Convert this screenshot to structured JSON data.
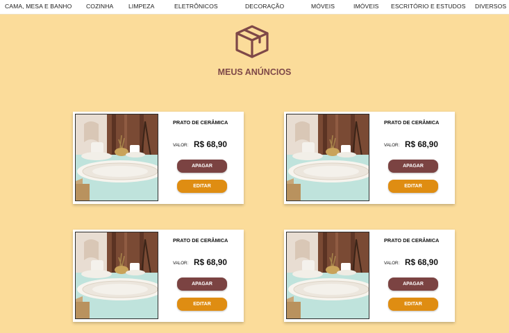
{
  "nav": [
    {
      "label": "CAMA, MESA E BANHO"
    },
    {
      "label": "COZINHA"
    },
    {
      "label": "LIMPEZA"
    },
    {
      "label": "ELETRÔNICOS"
    },
    {
      "label": "DECORAÇÃO"
    },
    {
      "label": "MÓVEIS"
    },
    {
      "label": "IMÓVEIS"
    },
    {
      "label": "ESCRITÓRIO E ESTUDOS"
    },
    {
      "label": "DIVERSOS"
    }
  ],
  "header": {
    "icon": "box-icon",
    "title": "MEUS ANÚNCIOS"
  },
  "listings": [
    {
      "name": "PRATO DE CERÂMICA",
      "price_label": "VALOR:",
      "price": "R$ 68,90",
      "delete_label": "APAGAR",
      "edit_label": "EDITAR"
    },
    {
      "name": "PRATO DE CERÂMICA",
      "price_label": "VALOR:",
      "price": "R$ 68,90",
      "delete_label": "APAGAR",
      "edit_label": "EDITAR"
    },
    {
      "name": "PRATO DE CERÂMICA",
      "price_label": "VALOR:",
      "price": "R$ 68,90",
      "delete_label": "APAGAR",
      "edit_label": "EDITAR"
    },
    {
      "name": "PRATO DE CERÂMICA",
      "price_label": "VALOR:",
      "price": "R$ 68,90",
      "delete_label": "APAGAR",
      "edit_label": "EDITAR"
    }
  ],
  "colors": {
    "background": "#fbdc9a",
    "accent": "#7e4848",
    "delete_button": "#7b4342",
    "edit_button": "#df8d12"
  }
}
